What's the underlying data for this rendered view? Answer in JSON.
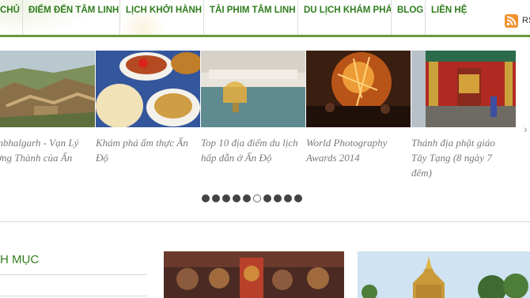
{
  "nav": {
    "items": [
      {
        "label": "CHỦ"
      },
      {
        "label": "ĐIỂM ĐẾN TÂM LINH"
      },
      {
        "label": "LỊCH KHỞI HÀNH"
      },
      {
        "label": "TẢI PHIM TÂM LINH"
      },
      {
        "label": "DU LỊCH KHÁM PHÁ"
      },
      {
        "label": "BLOG"
      },
      {
        "label": "LIÊN HỆ"
      }
    ],
    "rss_label": "RS",
    "rss_icon": "rss-icon"
  },
  "slider": {
    "slides": [
      {
        "caption": "ambhalgarh - Vạn Lý\nường Thành của Ấn\nộ"
      },
      {
        "caption": "Khám phá ẩm thực Ấn\nĐộ"
      },
      {
        "caption": "Top 10 địa điểm du lịch\nhấp dẫn ở Ấn Độ"
      },
      {
        "caption": "World Photography\nAwards 2014"
      },
      {
        "caption": "Thánh địa phật giáo\nTây Tạng (8 ngày 7\nđêm)"
      }
    ],
    "next_arrow": "›",
    "dot_count": 10,
    "active_dot": 5
  },
  "sidebar": {
    "category_title": "H MỤC"
  }
}
